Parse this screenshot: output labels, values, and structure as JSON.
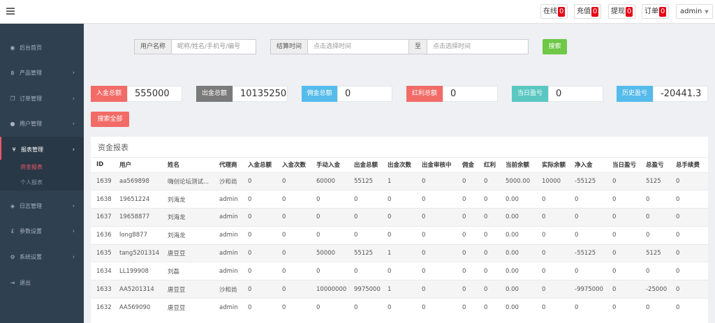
{
  "topbar": {
    "online_label": "在线",
    "online_count": "0",
    "recharge_label": "充值",
    "recharge_count": "0",
    "withdraw_label": "提现",
    "withdraw_count": "0",
    "order_label": "订单",
    "order_count": "0",
    "user": "admin"
  },
  "sidebar": {
    "items": [
      {
        "label": "后台首页",
        "icon": "dashboard-icon"
      },
      {
        "label": "产品管理",
        "icon": "bitcoin-icon"
      },
      {
        "label": "订单管理",
        "icon": "copy-icon"
      },
      {
        "label": "用户管理",
        "icon": "user-icon"
      },
      {
        "label": "报表管理",
        "icon": "yen-icon"
      },
      {
        "label": "日志管理",
        "icon": "tag-icon"
      },
      {
        "label": "参数设置",
        "icon": "pound-icon"
      },
      {
        "label": "系统设置",
        "icon": "gears-icon"
      },
      {
        "label": "退出",
        "icon": "sign-out-icon"
      }
    ],
    "sub_items": [
      {
        "label": "资金报表"
      },
      {
        "label": "个人报表"
      }
    ]
  },
  "search": {
    "username_label": "用户名称",
    "username_placeholder": "昵称/姓名/手机号/编号",
    "time_label": "结算时间",
    "time_start_placeholder": "点击选择时间",
    "time_sep": "至",
    "time_end_placeholder": "点击选择时间",
    "search_button": "搜索",
    "search_all_button": "搜索全部"
  },
  "stats": [
    {
      "label": "入金总额",
      "value": "555000",
      "color": "#f26b67"
    },
    {
      "label": "出金总额",
      "value": "10135250",
      "color": "#7a7a7a"
    },
    {
      "label": "佣金总额",
      "value": "0",
      "color": "#55bbea"
    },
    {
      "label": "红利总额",
      "value": "0",
      "color": "#f26b67"
    },
    {
      "label": "当日盈亏",
      "value": "0",
      "color": "#5ac7c2"
    },
    {
      "label": "历史盈亏",
      "value": "-20441.3",
      "color": "#55bbea"
    }
  ],
  "panel": {
    "title": "资金报表",
    "columns": [
      "ID",
      "用户",
      "姓名",
      "代理商",
      "入金总额",
      "入金次数",
      "手动入金",
      "出金总额",
      "出金次数",
      "出金审核中",
      "佣金",
      "红利",
      "当前余额",
      "实际余额",
      "净入金",
      "当日盈亏",
      "总盈亏",
      "总手续费"
    ],
    "rows": [
      [
        "1639",
        "aa569898",
        "嗨创论坛测试...",
        "沙和尚",
        "0",
        "0",
        "60000",
        "55125",
        "1",
        "0",
        "0",
        "0",
        "5000.00",
        "10000",
        "-55125",
        "0",
        "5125",
        "0"
      ],
      [
        "1638",
        "19651224",
        "刘海龙",
        "admin",
        "0",
        "0",
        "0",
        "0",
        "0",
        "0",
        "0",
        "0",
        "0.00",
        "0",
        "0",
        "0",
        "0",
        "0"
      ],
      [
        "1637",
        "19658877",
        "刘海龙",
        "admin",
        "0",
        "0",
        "0",
        "0",
        "0",
        "0",
        "0",
        "0",
        "0.00",
        "0",
        "0",
        "0",
        "0",
        "0"
      ],
      [
        "1636",
        "long8877",
        "刘海龙",
        "admin",
        "0",
        "0",
        "0",
        "0",
        "0",
        "0",
        "0",
        "0",
        "0.00",
        "0",
        "0",
        "0",
        "0",
        "0"
      ],
      [
        "1635",
        "tang5201314",
        "唐豆豆",
        "admin",
        "0",
        "0",
        "50000",
        "55125",
        "1",
        "0",
        "0",
        "0",
        "0.00",
        "0",
        "-55125",
        "0",
        "5125",
        "0"
      ],
      [
        "1634",
        "LL199908",
        "刘磊",
        "admin",
        "0",
        "0",
        "0",
        "0",
        "0",
        "0",
        "0",
        "0",
        "0.00",
        "0",
        "0",
        "0",
        "0",
        "0"
      ],
      [
        "1633",
        "AA5201314",
        "唐豆豆",
        "沙和尚",
        "0",
        "0",
        "10000000",
        "9975000",
        "1",
        "0",
        "0",
        "0",
        "0.00",
        "0",
        "-9975000",
        "0",
        "-25000",
        "0"
      ],
      [
        "1632",
        "AA569090",
        "唐豆豆",
        "admin",
        "0",
        "0",
        "0",
        "0",
        "0",
        "0",
        "0",
        "0",
        "0.00",
        "0",
        "0",
        "0",
        "0",
        "0"
      ]
    ]
  }
}
